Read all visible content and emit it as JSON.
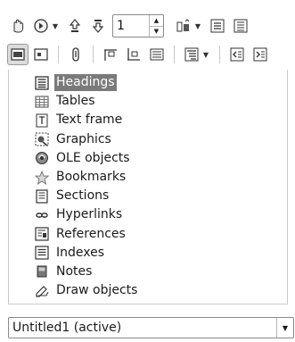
{
  "toolbar": {
    "page_number": "1"
  },
  "navigator": {
    "items": [
      {
        "label": "Headings",
        "icon": "headings-icon",
        "selected": true
      },
      {
        "label": "Tables",
        "icon": "table-icon"
      },
      {
        "label": "Text frame",
        "icon": "text-frame-icon"
      },
      {
        "label": "Graphics",
        "icon": "graphics-icon"
      },
      {
        "label": "OLE objects",
        "icon": "ole-object-icon"
      },
      {
        "label": "Bookmarks",
        "icon": "bookmark-star-icon"
      },
      {
        "label": "Sections",
        "icon": "section-icon"
      },
      {
        "label": "Hyperlinks",
        "icon": "hyperlink-icon"
      },
      {
        "label": "References",
        "icon": "reference-icon"
      },
      {
        "label": "Indexes",
        "icon": "index-icon"
      },
      {
        "label": "Notes",
        "icon": "note-icon"
      },
      {
        "label": "Draw objects",
        "icon": "draw-object-icon"
      }
    ]
  },
  "document_select": {
    "value": "Untitled1 (active)"
  },
  "colors": {
    "selection_bg": "#7a7a7a",
    "pressed_button_bg": "#dcdcdc"
  }
}
